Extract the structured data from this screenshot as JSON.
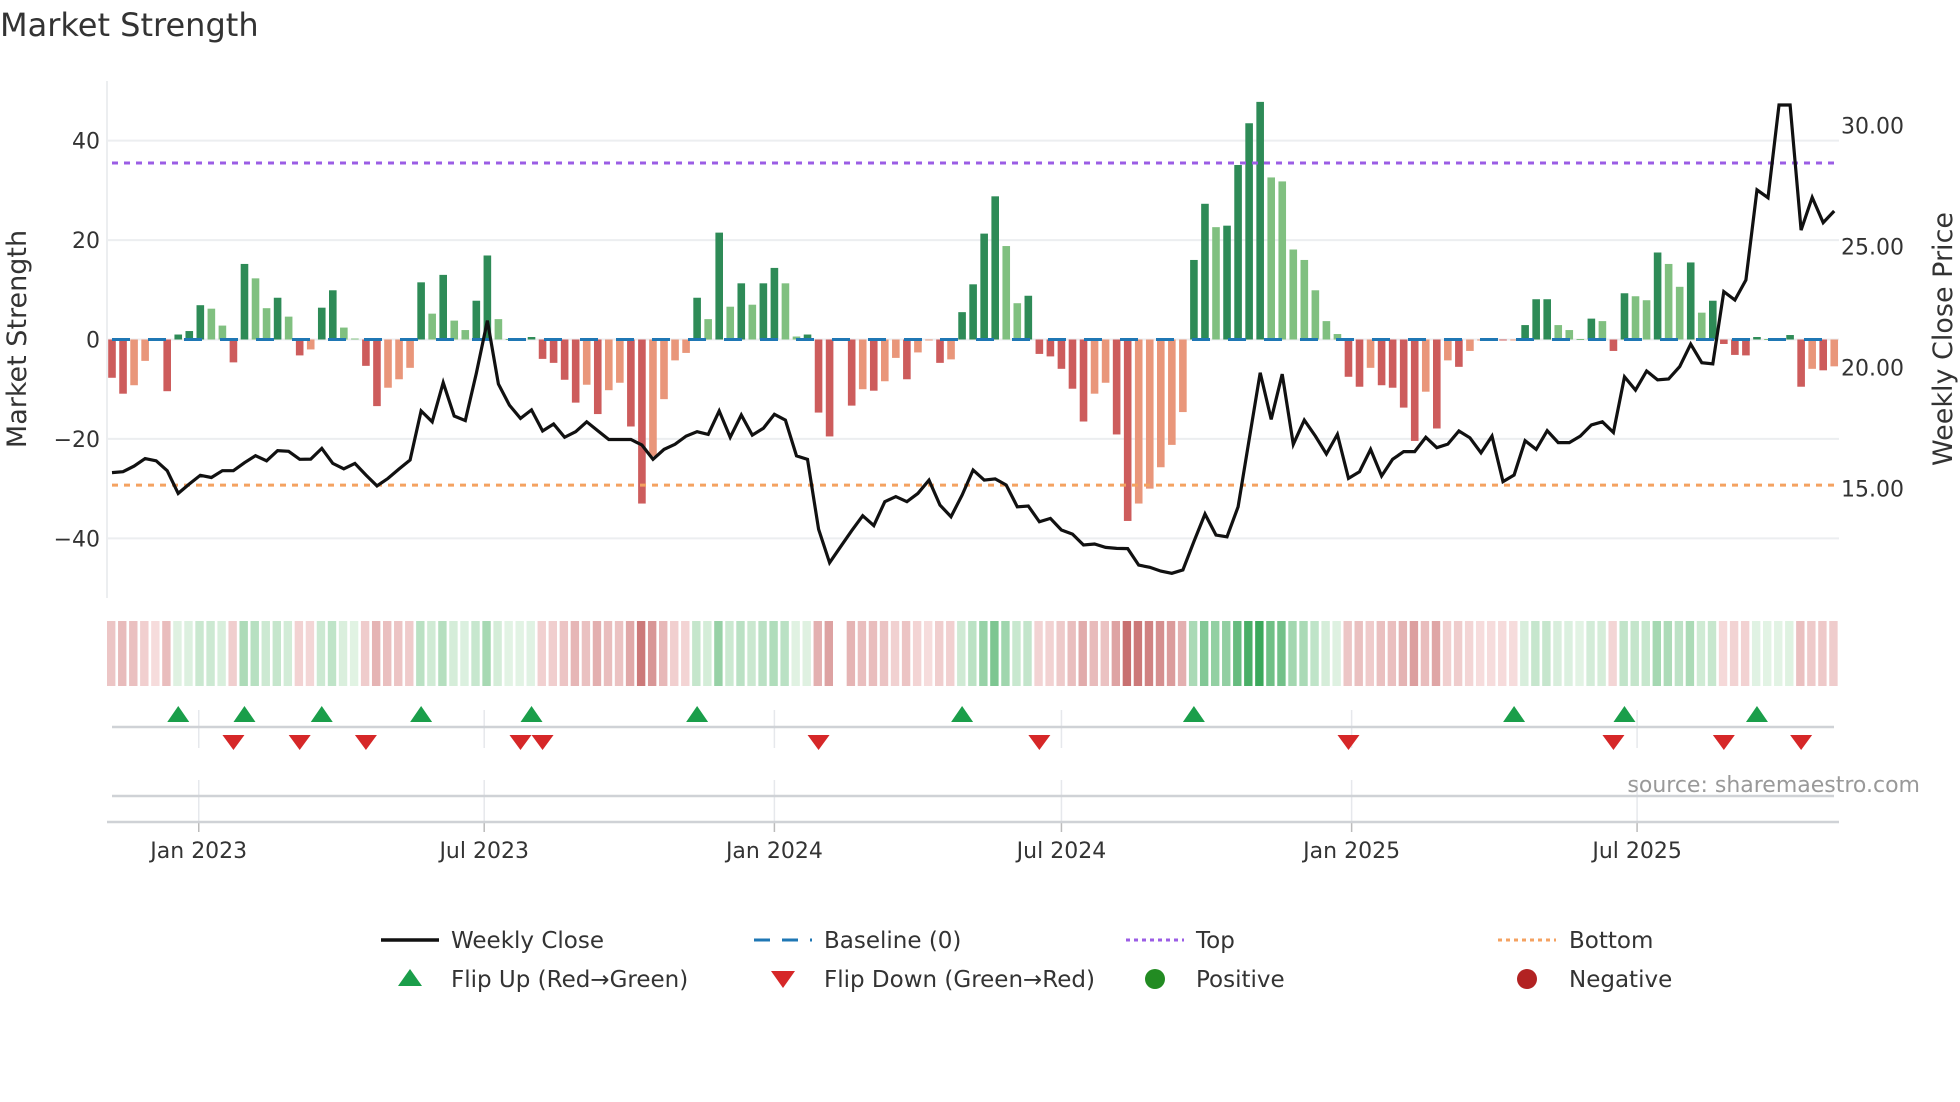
{
  "title": "Market Strength",
  "source": "source: sharemaestro.com",
  "chart_data": {
    "type": "bar+line",
    "title": "Market Strength",
    "ylabel_left": "Market Strength",
    "ylabel_right": "Weekly Close Price",
    "ylim_left": [
      -52,
      52
    ],
    "ylim_right": [
      10.47,
      31.83
    ],
    "left_ticks": [
      {
        "v": 40,
        "label": "40"
      },
      {
        "v": 20,
        "label": "20"
      },
      {
        "v": 0,
        "label": "0"
      },
      {
        "v": -20,
        "label": "−20"
      },
      {
        "v": -40,
        "label": "−40"
      }
    ],
    "right_ticks": [
      {
        "v": 30,
        "label": "30.00"
      },
      {
        "v": 25,
        "label": "25.00"
      },
      {
        "v": 20,
        "label": "20.00"
      },
      {
        "v": 15,
        "label": "15.00"
      }
    ],
    "x_ticks": [
      {
        "date": "2023-01-01",
        "label": "Jan 2023"
      },
      {
        "date": "2023-07-01",
        "label": "Jul 2023"
      },
      {
        "date": "2024-01-01",
        "label": "Jan 2024"
      },
      {
        "date": "2024-07-01",
        "label": "Jul 2024"
      },
      {
        "date": "2025-01-01",
        "label": "Jan 2025"
      },
      {
        "date": "2025-07-01",
        "label": "Jul 2025"
      }
    ],
    "start_date": "2022-11-07",
    "interval": "weekly",
    "top_threshold": 35.5,
    "bottom_threshold": -29.3,
    "baseline": 0,
    "strength": [
      -7.7,
      -10.9,
      -9.2,
      -4.3,
      -0.1,
      -10.4,
      1,
      1.7,
      6.9,
      6.2,
      2.8,
      -4.6,
      15.2,
      12.3,
      6.3,
      8.4,
      4.6,
      -3.2,
      -2,
      6.4,
      9.9,
      2.4,
      0.2,
      -5.3,
      -13.4,
      -9.7,
      -8,
      -5.7,
      11.5,
      5.2,
      13,
      3.8,
      1.9,
      7.8,
      16.9,
      4.1,
      0.1,
      0.1,
      0.5,
      -3.9,
      -4.7,
      -8.1,
      -12.7,
      -9.1,
      -15,
      -10.2,
      -8.7,
      -17.5,
      -33,
      -23.5,
      -12,
      -4.2,
      -2.7,
      8.4,
      4.1,
      21.5,
      6.6,
      11.3,
      7,
      11.3,
      14.4,
      11.3,
      0.6,
      1,
      -14.7,
      -19.5,
      0,
      -13.3,
      -10,
      -10.3,
      -8.4,
      -3.7,
      -8,
      -2.6,
      -0.1,
      -4.7,
      -4,
      5.5,
      11.1,
      21.3,
      28.8,
      18.8,
      7.3,
      8.8,
      -2.9,
      -3.4,
      -5.9,
      -9.9,
      -16.5,
      -10.9,
      -8.7,
      -19.1,
      -36.5,
      -33,
      -30,
      -25.7,
      -21.2,
      -14.6,
      16,
      27.3,
      22.6,
      22.9,
      35.1,
      43.5,
      47.8,
      32.6,
      31.8,
      18.1,
      16,
      9.9,
      3.7,
      1.1,
      -7.5,
      -9.5,
      -5.7,
      -9.2,
      -9.7,
      -13.7,
      -20.4,
      -10.5,
      -17.9,
      -4.2,
      -5.5,
      -2.3,
      -0.1,
      -0.1,
      -0.2,
      -0.1,
      2.9,
      8.1,
      8.1,
      2.9,
      1.9,
      0.1,
      4.2,
      3.7,
      -2.3,
      9.3,
      8.7,
      7.9,
      17.5,
      15.2,
      10.6,
      15.5,
      5.4,
      7.8,
      -0.9,
      -3.1,
      -3.2,
      0.5,
      0.1,
      0.1,
      0.9,
      -9.5,
      -5.9,
      -6.2,
      -5.4
    ],
    "weekly_close": [
      15.65,
      15.69,
      15.92,
      16.23,
      16.14,
      15.73,
      14.79,
      15.18,
      15.54,
      15.45,
      15.73,
      15.73,
      16.06,
      16.35,
      16.14,
      16.56,
      16.53,
      16.2,
      16.21,
      16.65,
      16.03,
      15.81,
      16.03,
      15.55,
      15.1,
      15.41,
      15.8,
      16.17,
      18.2,
      17.75,
      19.37,
      17.99,
      17.8,
      19.75,
      21.93,
      19.31,
      18.44,
      17.89,
      18.24,
      17.37,
      17.66,
      17.11,
      17.34,
      17.75,
      17.38,
      17.02,
      17.02,
      17.02,
      16.79,
      16.2,
      16.61,
      16.82,
      17.16,
      17.34,
      17.23,
      18.2,
      17.11,
      18.03,
      17.2,
      17.48,
      18.06,
      17.82,
      16.34,
      16.2,
      13.31,
      11.93,
      12.59,
      13.25,
      13.87,
      13.46,
      14.45,
      14.66,
      14.45,
      14.79,
      15.34,
      14.31,
      13.83,
      14.72,
      15.76,
      15.34,
      15.39,
      15.14,
      14.24,
      14.27,
      13.62,
      13.76,
      13.28,
      13.11,
      12.66,
      12.7,
      12.56,
      12.52,
      12.51,
      11.83,
      11.74,
      11.58,
      11.49,
      11.63,
      12.8,
      13.94,
      13.07,
      13,
      14.24,
      17,
      19.78,
      17.85,
      19.72,
      16.82,
      17.82,
      17.16,
      16.42,
      17.23,
      15.41,
      15.69,
      16.61,
      15.51,
      16.2,
      16.52,
      16.52,
      17.11,
      16.68,
      16.83,
      17.37,
      17.09,
      16.47,
      17.16,
      15.28,
      15.55,
      16.97,
      16.61,
      17.38,
      16.89,
      16.89,
      17.16,
      17.62,
      17.75,
      17.31,
      19.61,
      19.06,
      19.85,
      19.48,
      19.52,
      20.03,
      20.96,
      20.19,
      20.14,
      23.13,
      22.78,
      23.61,
      27.33,
      27.01,
      30.84,
      30.84,
      25.67,
      27.02,
      25.98,
      26.46
    ],
    "flip_up_weeks": [
      6,
      12,
      19,
      28,
      38,
      53,
      77,
      98,
      127,
      137,
      149
    ],
    "flip_down_weeks": [
      11,
      17,
      23,
      37,
      39,
      64,
      84,
      112,
      136,
      146,
      153
    ],
    "legend": [
      {
        "key": "weekly_close",
        "label": "Weekly Close"
      },
      {
        "key": "baseline",
        "label": "Baseline (0)"
      },
      {
        "key": "top",
        "label": "Top"
      },
      {
        "key": "bottom",
        "label": "Bottom"
      },
      {
        "key": "flip_up",
        "label": "Flip Up (Red→Green)"
      },
      {
        "key": "flip_down",
        "label": "Flip Down (Green→Red)"
      },
      {
        "key": "positive",
        "label": "Positive"
      },
      {
        "key": "negative",
        "label": "Negative"
      }
    ],
    "legend_placement": "bottom",
    "colors": {
      "pos_rising": "#2e8b57",
      "pos_falling": "#80c080",
      "neg_rising": "#cd5c5c",
      "neg_falling": "#e9967a",
      "line": "#111111",
      "baseline": "#1f77b4",
      "top": "#9b5de5",
      "bottom": "#f4a261",
      "flip_up": "#1a9e4a",
      "flip_down": "#d62728",
      "positive": "#228b22",
      "negative": "#b22222"
    }
  }
}
